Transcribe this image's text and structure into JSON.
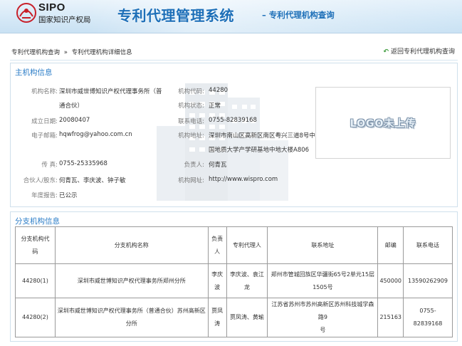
{
  "header": {
    "logo_en": "SIPO",
    "logo_cn": "国家知识产权局",
    "system_title": "专利代理管理系统",
    "system_subtitle": "– 专利代理机构查询"
  },
  "breadcrumb": {
    "item1": "专利代理机构查询",
    "separator": "»",
    "item2": "专利代理机构详细信息"
  },
  "back_link": "返回专利代理机构查询",
  "main_section": {
    "title": "主机构信息",
    "name_label": "机构名称:",
    "name_line1": "深圳市威世博知识产权代理事务所（普",
    "name_line2": "通合伙）",
    "code_label": "机构代码:",
    "code": "44280",
    "status_label": "机构状态:",
    "status": "正常",
    "founded_label": "成立日期:",
    "founded": "20080407",
    "phone_label": "联系电话:",
    "phone": "0755-82839168",
    "email_label": "电子邮箱:",
    "email": "hqwfrog@yahoo.com.cn",
    "address_label": "机构地址:",
    "address_line1": "深圳市南山区高新区南区粤兴三道8号中",
    "address_line2": "国地质大学产学研基地中地大楼A806",
    "fax_label": "传 真:",
    "fax": "0755-25335968",
    "leader_label": "负责人:",
    "leader": "何青瓦",
    "partners_label": "合伙人/股东:",
    "partners": "何青瓦、李庆波、钟子敏",
    "website_label": "机构网址:",
    "website": "http://www.wispro.com",
    "annual_label": "年度报告:",
    "annual": "已公示",
    "logo_placeholder": "LOGO未上传"
  },
  "branch_section": {
    "title": "分支机构信息",
    "columns": {
      "code_l1": "分支机构代",
      "code_l2": "码",
      "name": "分支机构名称",
      "leader_l1": "负责",
      "leader_l2": "人",
      "agents": "专利代理人",
      "address": "联系地址",
      "postcode": "邮编",
      "phone": "联系电话"
    },
    "rows": [
      {
        "code": "44280(1)",
        "name": "深圳市威世博知识产权代理事务所郑州分所",
        "leader_l1": "李庆",
        "leader_l2": "波",
        "agents_l1": "李庆波、袁江",
        "agents_l2": "龙",
        "address_l1": "郑州市管城回族区华疆街65号2单元15层",
        "address_l2": "1505号",
        "postcode": "450000",
        "phone": "13590262909"
      },
      {
        "code": "44280(2)",
        "name_l1": "深圳市威世博知识产权代理事务所（普通合伙）苏州高新区",
        "name_l2": "分所",
        "leader_l1": "贾凤",
        "leader_l2": "涛",
        "agents": "贾凤涛、黄瑜",
        "address_l1": "江苏省苏州市苏州高新区苏州科技城学森路9",
        "address_l2": "号",
        "postcode": "215163",
        "phone_l1": "0755-",
        "phone_l2": "82839168"
      }
    ]
  },
  "colors": {
    "accent_blue": "#2a7cc7",
    "title_blue": "#1d6fb8",
    "back_arrow_green": "#3a9a3a"
  }
}
